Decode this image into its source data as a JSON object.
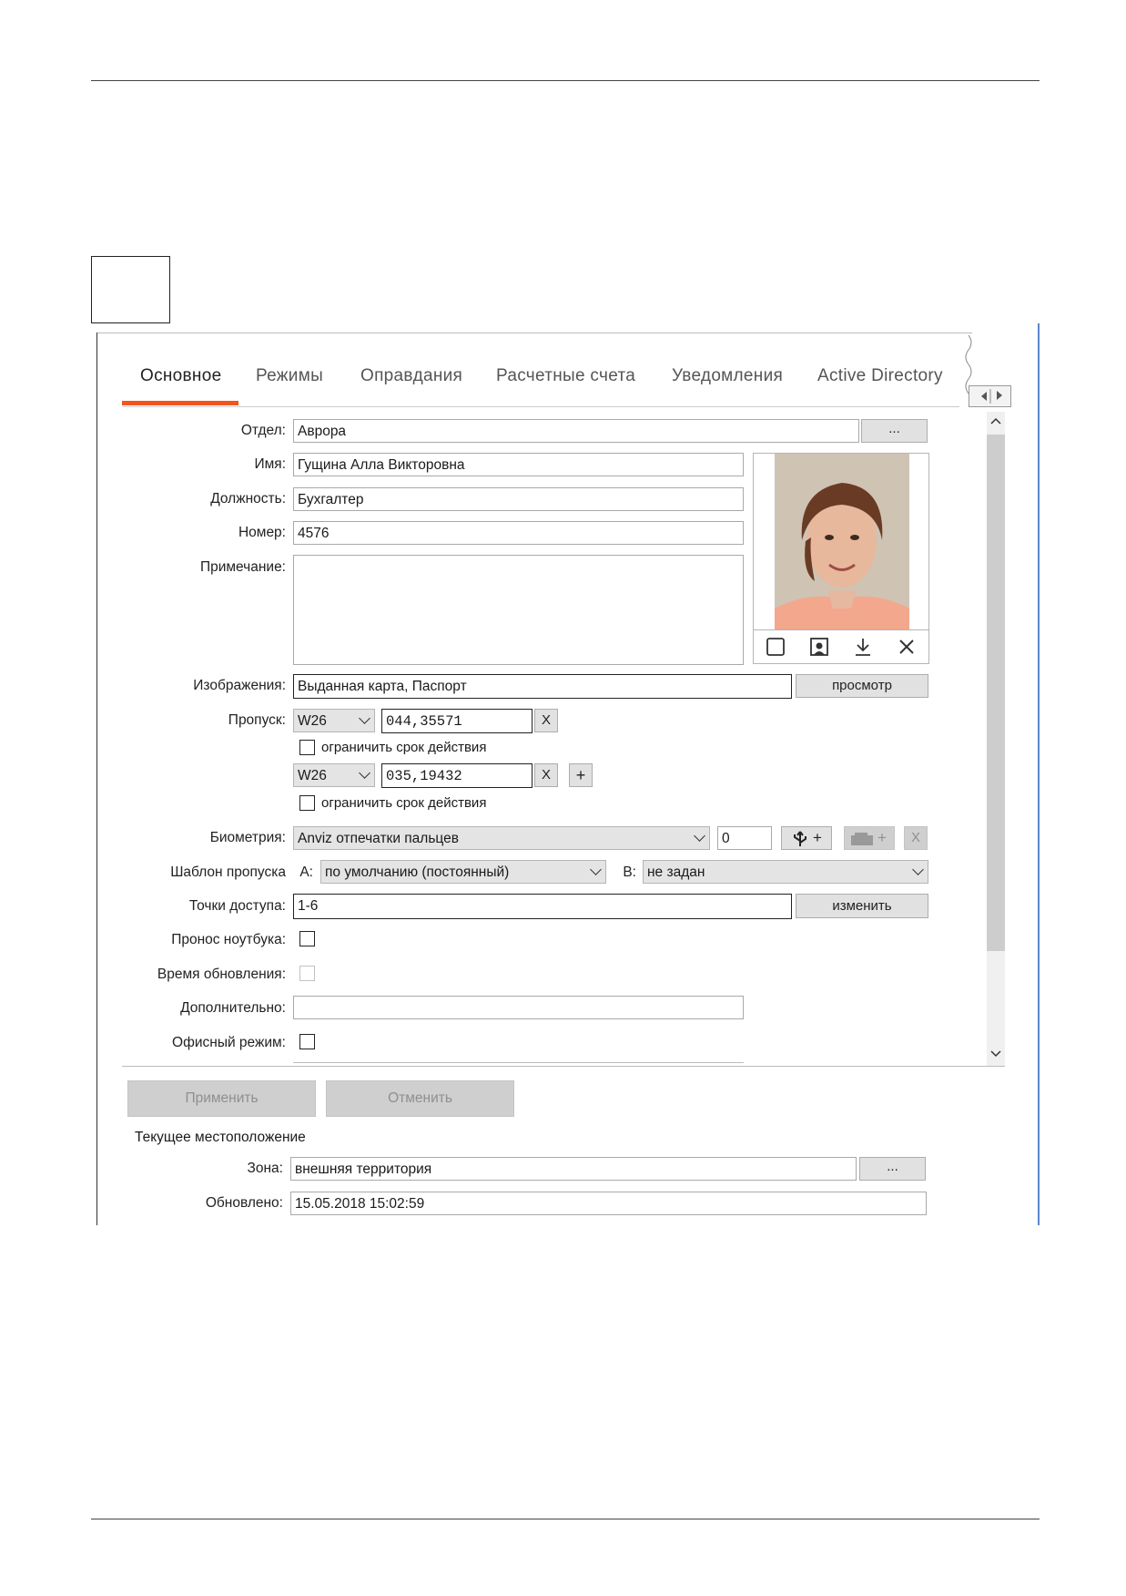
{
  "tabs": [
    "Основное",
    "Режимы",
    "Оправдания",
    "Расчетные счета",
    "Уведомления",
    "Active Directory"
  ],
  "form": {
    "department": {
      "label": "Отдел:",
      "value": "Аврора",
      "button": "..."
    },
    "name": {
      "label": "Имя:",
      "value": "Гущина Алла Викторовна"
    },
    "position": {
      "label": "Должность:",
      "value": "Бухгалтер"
    },
    "number": {
      "label": "Номер:",
      "value": "4576"
    },
    "note": {
      "label": "Примечание:",
      "value": ""
    },
    "images": {
      "label": "Изображения:",
      "value": "Выданная карта, Паспорт",
      "button": "просмотр"
    },
    "pass": {
      "label": "Пропуск:",
      "rows": [
        {
          "format": "W26",
          "code": "044,35571",
          "remove": "X",
          "limit_label": "ограничить срок действия"
        },
        {
          "format": "W26",
          "code": "035,19432",
          "remove": "X",
          "add": "+",
          "limit_label": "ограничить срок действия"
        }
      ]
    },
    "biometry": {
      "label": "Биометрия:",
      "value": "Anviz отпечатки пальцев",
      "count": "0",
      "add": "+",
      "remove": "X"
    },
    "template": {
      "label": "Шаблон пропуска",
      "a_label": "А:",
      "a_value": "по умолчанию (постоянный)",
      "b_label": "В:",
      "b_value": "не задан"
    },
    "access_points": {
      "label": "Точки доступа:",
      "value": "1-6",
      "button": "изменить"
    },
    "laptop": {
      "label": "Пронос ноутбука:"
    },
    "update_time": {
      "label": "Время обновления:"
    },
    "additional": {
      "label": "Дополнительно:",
      "value": ""
    },
    "office_mode": {
      "label": "Офисный режим:"
    }
  },
  "actions": {
    "apply": "Применить",
    "cancel": "Отменить"
  },
  "location": {
    "title": "Текущее местоположение",
    "zone_label": "Зона:",
    "zone_value": "внешняя территория",
    "zone_button": "...",
    "updated_label": "Обновлено:",
    "updated_value": "15.05.2018 15:02:59"
  },
  "colors": {
    "accent": "#f0571c",
    "frame": "#5b86c9"
  },
  "photo_toolbar_icons": [
    "blank-icon",
    "portrait-icon",
    "download-icon",
    "close-icon"
  ]
}
